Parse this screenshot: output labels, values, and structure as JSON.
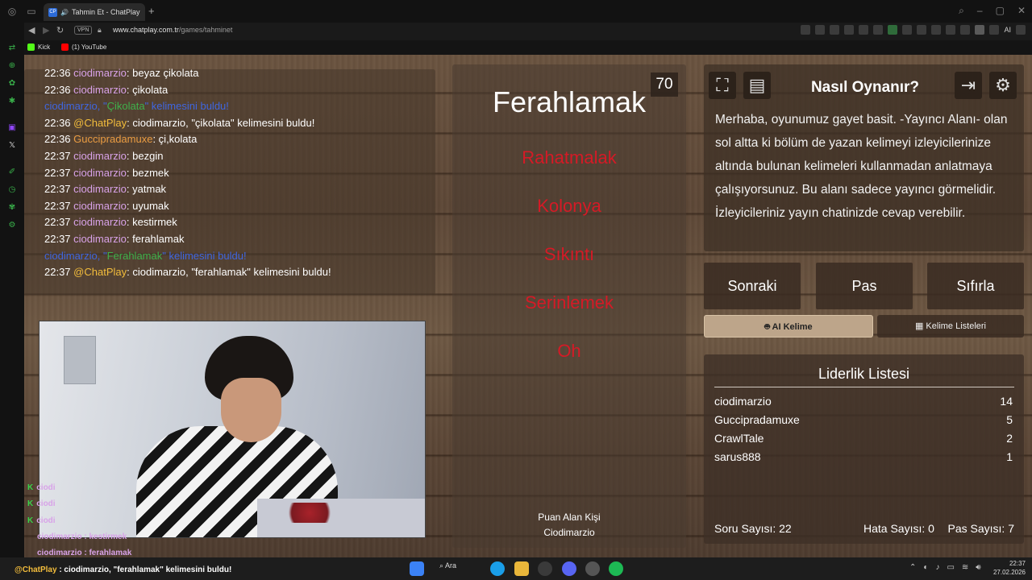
{
  "browser": {
    "tab_title": "Tahmin Et - ChatPlay",
    "new_tab": "+",
    "vpn": "VPN",
    "url_domain": "www.chatplay.com.tr",
    "url_path": "/games/tahminet",
    "ext_label": "AI",
    "bookmarks": [
      "Kick",
      "(1) YouTube"
    ]
  },
  "chat": {
    "lines": [
      {
        "time": "22:36",
        "nick": "ciodimarzio",
        "msg": ": beyaz çikolata"
      },
      {
        "time": "22:36",
        "nick": "ciodimarzio",
        "msg": ": çikolata"
      },
      {
        "found_pre": "ciodimarzio, \"",
        "found_word": "Çikolata",
        "found_post": "\" kelimesini buldu!"
      },
      {
        "time": "22:36",
        "cp": "@ChatPlay",
        "msg": ": ciodimarzio, \"çikolata\" kelimesini buldu!"
      },
      {
        "time": "22:36",
        "nick2": "Guccipradamuxe",
        "msg": ": çi,kolata"
      },
      {
        "time": "22:37",
        "nick": "ciodimarzio",
        "msg": ": bezgin"
      },
      {
        "time": "22:37",
        "nick": "ciodimarzio",
        "msg": ": bezmek"
      },
      {
        "time": "22:37",
        "nick": "ciodimarzio",
        "msg": ": yatmak"
      },
      {
        "time": "22:37",
        "nick": "ciodimarzio",
        "msg": ": uyumak"
      },
      {
        "time": "22:37",
        "nick": "ciodimarzio",
        "msg": ": kestirmek"
      },
      {
        "time": "22:37",
        "nick": "ciodimarzio",
        "msg": ": ferahlamak"
      },
      {
        "found_pre": "ciodimarzio, \"",
        "found_word": "Ferahlamak",
        "found_post": "\" kelimesini buldu!"
      },
      {
        "time": "22:37",
        "cp": "@ChatPlay",
        "msg": ": ciodimarzio, \"ferahlamak\" kelimesini buldu!"
      }
    ]
  },
  "overlay": {
    "lines": [
      "ciodi",
      "ciodi",
      "ciodi",
      "ciodimarzio : kestirmek",
      "ciodimarzio : ferahlamak"
    ],
    "last": {
      "cp": "@ChatPlay",
      "msg": " : ciodimarzio, \"ferahlamak\" kelimesini buldu!"
    }
  },
  "game": {
    "score": "70",
    "word": "Ferahlamak",
    "forbidden": [
      "Rahatmalak",
      "Kolonya",
      "Sıkıntı",
      "Serinlemek",
      "Oh"
    ],
    "scorer_label": "Puan Alan Kişi",
    "scorer_name": "Ciodimarzio"
  },
  "howto": {
    "title": "Nasıl Oynanır?",
    "text": "Merhaba, oyunumuz gayet basit. -Yayıncı Alanı- olan sol altta ki bölüm de yazan kelimeyi izleyicilerinize altında bulunan kelimeleri kullanmadan anlatmaya çalışıyorsunuz. Bu alanı sadece yayıncı görmelidir. İzleyicileriniz yayın chatinizde cevap verebilir."
  },
  "controls": {
    "next": "Sonraki",
    "pass": "Pas",
    "reset": "Sıfırla",
    "ai_word": "AI Kelime",
    "word_lists": "Kelime Listeleri"
  },
  "leaderboard": {
    "title": "Liderlik Listesi",
    "rows": [
      {
        "name": "ciodimarzio",
        "score": "14"
      },
      {
        "name": "Guccipradamuxe",
        "score": "5"
      },
      {
        "name": "CrawlTale",
        "score": "2"
      },
      {
        "name": "sarus888",
        "score": "1"
      }
    ],
    "questions": "Soru Sayısı: 22",
    "errors": "Hata Sayısı: 0",
    "passes": "Pas Sayısı: 7"
  },
  "taskbar": {
    "search": "Ara",
    "time": "22:37",
    "date": "27.02.2026"
  },
  "colors": {
    "forbidden": "#d51a26",
    "nick": "#d8a2e8",
    "chatplay": "#f3bd3c",
    "found": "#3f66e0",
    "found_word": "#3fb04b"
  }
}
